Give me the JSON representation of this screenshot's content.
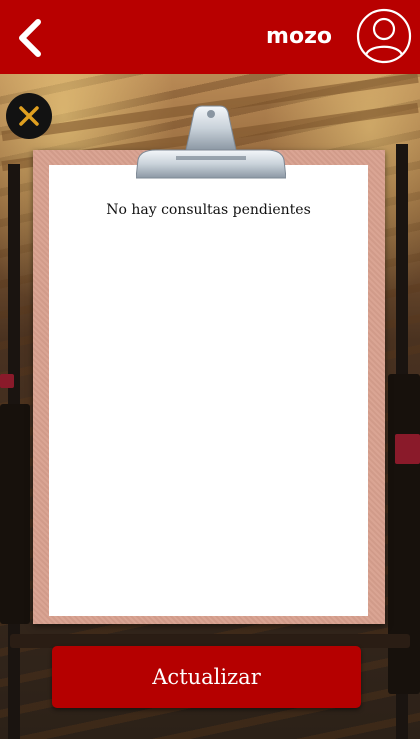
{
  "header": {
    "username": "mozo",
    "back_icon": "chevron-left-icon",
    "avatar_icon": "user-circle-icon"
  },
  "close_icon": "close-icon",
  "clipboard": {
    "message": "No hay consultas pendientes"
  },
  "refresh_label": "Actualizar",
  "colors": {
    "header": "#b80000",
    "button": "#b50000",
    "board": "#d8a08e",
    "close_x": "#e0a020"
  }
}
